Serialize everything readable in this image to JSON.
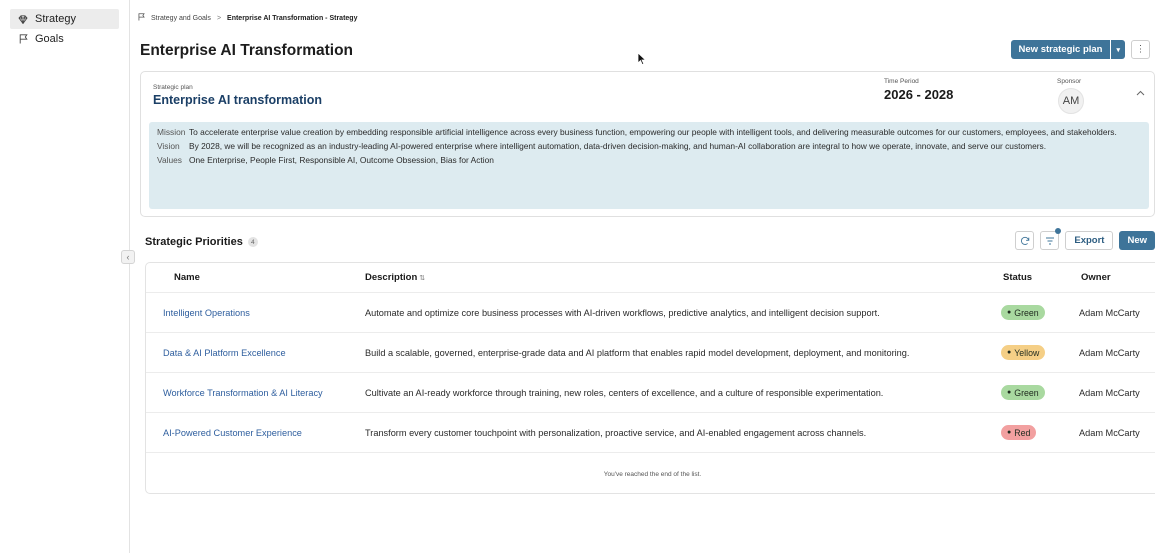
{
  "sidebar": {
    "items": [
      {
        "label": "Strategy",
        "icon": "gem-icon",
        "active": true
      },
      {
        "label": "Goals",
        "icon": "flag-icon",
        "active": false
      }
    ]
  },
  "breadcrumb": {
    "parent": "Strategy and Goals",
    "separator": ">",
    "current": "Enterprise AI Transformation - Strategy"
  },
  "header": {
    "title": "Enterprise AI Transformation",
    "new_plan_label": "New strategic plan",
    "caret": "▾",
    "more": "⋮"
  },
  "plan": {
    "label": "Strategic plan",
    "name": "Enterprise AI transformation",
    "period_label": "Time Period",
    "period_value": "2026 - 2028",
    "sponsor_label": "Sponsor",
    "sponsor_initials": "AM",
    "collapse_glyph": "^",
    "mission_label": "Mission",
    "mission": "To accelerate enterprise value creation by embedding responsible artificial intelligence across every business function, empowering our people with intelligent tools, and delivering measurable outcomes for our customers, employees, and stakeholders.",
    "vision_label": "Vision",
    "vision": "By 2028, we will be recognized as an industry-leading AI-powered enterprise where intelligent automation, data-driven decision-making, and human-AI collaboration are integral to how we operate, innovate, and serve our customers.",
    "values_label": "Values",
    "values": "One Enterprise, People First, Responsible AI, Outcome Obsession, Bias for Action"
  },
  "priorities": {
    "title": "Strategic Priorities",
    "count": "4",
    "export_label": "Export",
    "new_label": "New",
    "columns": {
      "name": "Name",
      "description": "Description",
      "status": "Status",
      "owner": "Owner"
    },
    "sort_glyph": "⇅",
    "rows": [
      {
        "name": "Intelligent Operations",
        "description": "Automate and optimize core business processes with AI-driven workflows, predictive analytics, and intelligent decision support.",
        "status": "Green",
        "owner": "Adam McCarty"
      },
      {
        "name": "Data & AI Platform Excellence",
        "description": "Build a scalable, governed, enterprise-grade data and AI platform that enables rapid model development, deployment, and monitoring.",
        "status": "Yellow",
        "owner": "Adam McCarty"
      },
      {
        "name": "Workforce Transformation & AI Literacy",
        "description": "Cultivate an AI-ready workforce through training, new roles, centers of excellence, and a culture of responsible experimentation.",
        "status": "Green",
        "owner": "Adam McCarty"
      },
      {
        "name": "AI-Powered Customer Experience",
        "description": "Transform every customer touchpoint with personalization, proactive service, and AI-enabled engagement across channels.",
        "status": "Red",
        "owner": "Adam McCarty"
      }
    ],
    "end_message": "You've reached the end of the list."
  },
  "colors": {
    "primary": "#3e7499",
    "link": "#2e5e9e",
    "mission_bg": "#ddebf0",
    "status_green": "#a9d9a0",
    "status_yellow": "#f5cf86",
    "status_red": "#f2a0a0"
  }
}
